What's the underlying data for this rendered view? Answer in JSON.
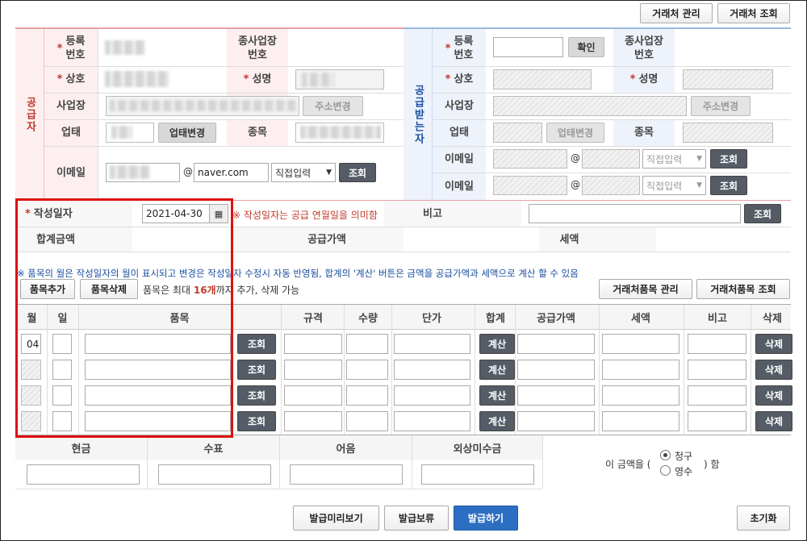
{
  "top_buttons": {
    "manage": "거래처 관리",
    "lookup": "거래처 조회"
  },
  "supplier": {
    "side_label": "공급자",
    "reg_no_label": "등록\n번호",
    "branch_label": "종사업장\n번호",
    "company_label": "상호",
    "ceo_label": "성명",
    "address_label": "사업장",
    "address_change": "주소변경",
    "biz_type_label": "업태",
    "biz_type_change": "업태변경",
    "item_label": "종목",
    "email_label": "이메일",
    "email_at": "@",
    "email_domain": "naver.com",
    "email_select": "직접입력",
    "email_lookup": "조회"
  },
  "receiver": {
    "side_label": "공급받는자",
    "reg_no_label": "등록\n번호",
    "confirm": "확인",
    "branch_label": "종사업장\n번호",
    "company_label": "상호",
    "ceo_label": "성명",
    "address_label": "사업장",
    "address_change": "주소변경",
    "biz_type_label": "업태",
    "biz_type_change": "업태변경",
    "item_label": "종목",
    "email_label": "이메일",
    "email_at": "@",
    "email_select": "직접입력",
    "email_lookup": "조회"
  },
  "summary": {
    "date_label": "작성일자",
    "date_value": "2021-04-30",
    "date_note": "※ 작성일자는 공급 연월일을 의미함",
    "remark_label": "비고",
    "remark_lookup": "조회",
    "total_label": "합계금액",
    "supply_label": "공급가액",
    "tax_label": "세액"
  },
  "items_note": "※ 품목의 월은 작성일자의 월이 표시되고 변경은 작성일자 수정시 자동 반영됨, 합계의 '계산' 버튼은 금액을 공급가액과 세액으로 계산 할 수 있음",
  "item_controls": {
    "add": "품목추가",
    "delete": "품목삭제",
    "limit_pre": "품목은 최대 ",
    "limit_num": "16개",
    "limit_post": "까지 추가, 삭제 가능",
    "manage": "거래처품목 관리",
    "lookup": "거래처품목 조회"
  },
  "table": {
    "headers": [
      "월",
      "일",
      "품목",
      "규격",
      "수량",
      "단가",
      "합계",
      "공급가액",
      "세액",
      "비고",
      "삭제"
    ],
    "rows": [
      {
        "month": "04",
        "lookup": "조회",
        "calc": "계산",
        "del": "삭제"
      },
      {
        "month": "",
        "lookup": "조회",
        "calc": "계산",
        "del": "삭제"
      },
      {
        "month": "",
        "lookup": "조회",
        "calc": "계산",
        "del": "삭제"
      },
      {
        "month": "",
        "lookup": "조회",
        "calc": "계산",
        "del": "삭제"
      }
    ]
  },
  "payment": {
    "cash": "현금",
    "check": "수표",
    "bill": "어음",
    "credit": "외상미수금",
    "amount_pre": "이 금액을 (",
    "opt_claim": "청구",
    "opt_receipt": "영수",
    "amount_post": ") 함"
  },
  "footer": {
    "preview": "발급미리보기",
    "hold": "발급보류",
    "issue": "발급하기",
    "reset": "초기화"
  },
  "colors": {
    "accent_red": "#c0392b",
    "issue_blue": "#2c6fc2",
    "highlight": "#e01010"
  }
}
